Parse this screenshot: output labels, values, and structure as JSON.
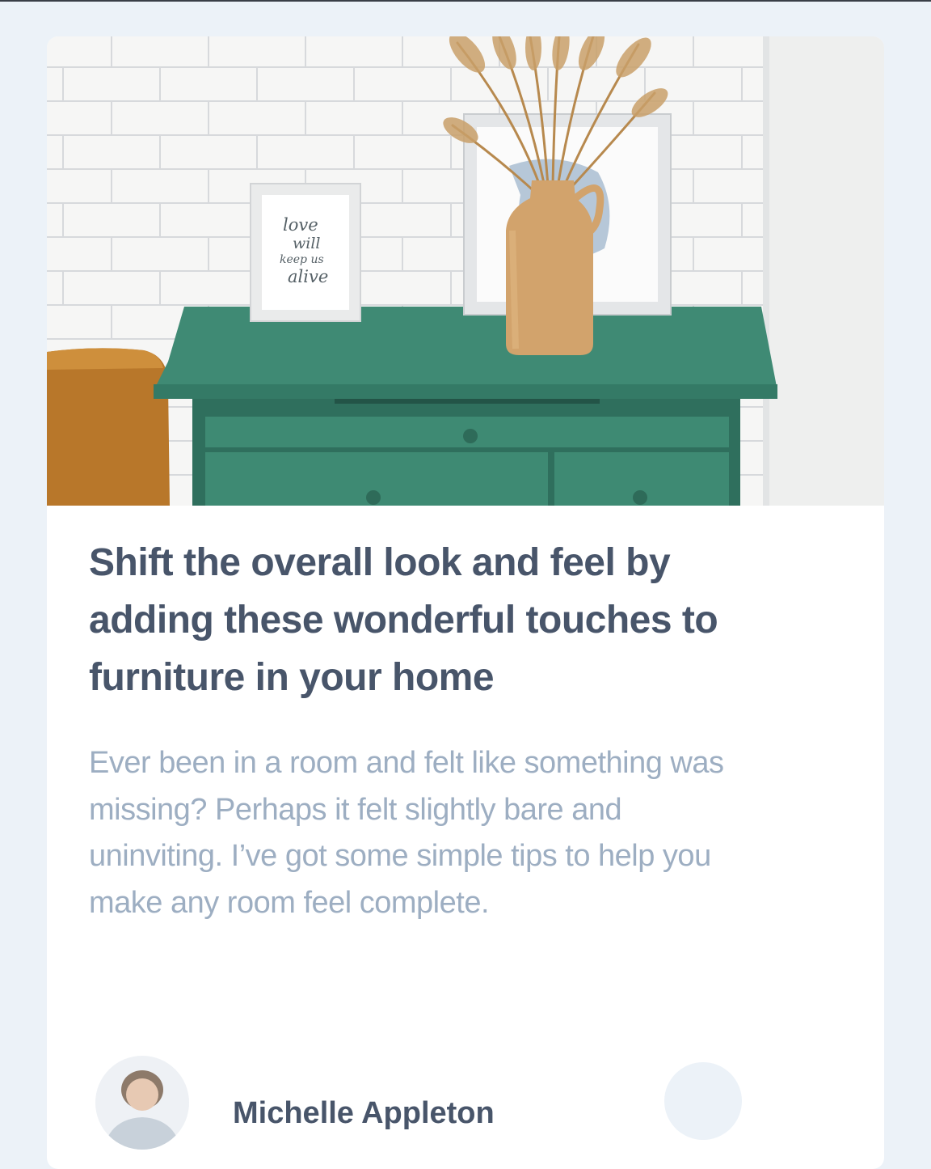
{
  "article": {
    "image_alt": "Green drawers with a vase of dried grass, a framed print and a framed lettering sign in front of a white brick wall",
    "image_lettering": [
      "love",
      "will",
      "keep us",
      "alive"
    ],
    "title": "Shift the overall look and feel by adding these wonderful touches to furniture in your home",
    "excerpt": "Ever been in a room and felt like something was missing? Perhaps it felt slightly bare and uninviting. I’ve got some simple tips to help you make any room feel complete.",
    "author": {
      "name": "Michelle Appleton",
      "avatar_icon": "avatar-photo"
    },
    "share_icon": "share-icon"
  },
  "colors": {
    "page_background": "#ECF2F8",
    "card_background": "#FFFFFF",
    "heading_text": "#48556A",
    "body_text": "#9DAEC2",
    "dresser_green": "#3F8A74",
    "vase_tan": "#D2A36C"
  }
}
